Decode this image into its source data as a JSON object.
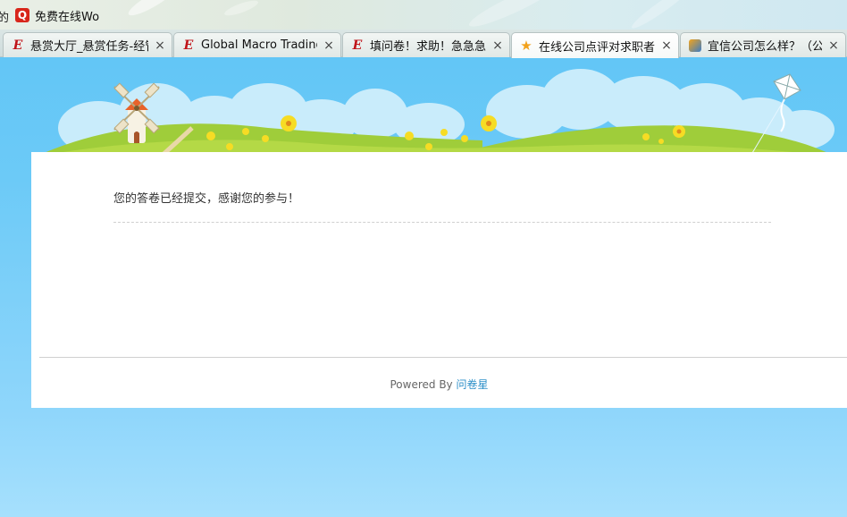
{
  "bookmark_bar": {
    "edge_fragment": "的",
    "bookmark": {
      "icon": "q-icon",
      "icon_letter": "Q",
      "label": "免费在线Wo"
    }
  },
  "tabs": [
    {
      "icon": "e-icon",
      "icon_glyph": "E",
      "title": "悬赏大厅_悬赏任务-经管",
      "close": "×"
    },
    {
      "icon": "e-icon",
      "icon_glyph": "E",
      "title": "Global Macro Trading:",
      "close": "×"
    },
    {
      "icon": "e-icon",
      "icon_glyph": "E",
      "title": "填问卷！求助！急急急！",
      "close": "×"
    },
    {
      "icon": "star-icon",
      "icon_glyph": "★",
      "title": "在线公司点评对求职者由",
      "close": "×",
      "active": true
    },
    {
      "icon": "j-icon",
      "icon_glyph": "",
      "title": "宜信公司怎么样？（公司",
      "close": "×"
    }
  ],
  "survey": {
    "message": "您的答卷已经提交，感谢您的参与！"
  },
  "footer": {
    "powered_by": "Powered By",
    "brand_link": "问卷星"
  },
  "colors": {
    "background_sky": "#6ccaf7",
    "link": "#2c8fc8",
    "favicon_e": "#c0141a",
    "favicon_q": "#d8261b"
  }
}
